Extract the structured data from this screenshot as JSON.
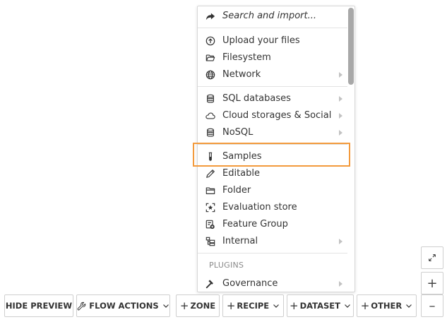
{
  "menu": {
    "items": [
      {
        "label": "Search and import...",
        "icon": "share-arrow-icon",
        "has_submenu": false
      },
      {
        "label": "Upload your files",
        "icon": "upload-circle-icon",
        "has_submenu": false
      },
      {
        "label": "Filesystem",
        "icon": "folder-open-icon",
        "has_submenu": false
      },
      {
        "label": "Network",
        "icon": "globe-icon",
        "has_submenu": true
      },
      {
        "label": "SQL databases",
        "icon": "database-icon",
        "has_submenu": true
      },
      {
        "label": "Cloud storages & Social",
        "icon": "cloud-icon",
        "has_submenu": true
      },
      {
        "label": "NoSQL",
        "icon": "database-icon",
        "has_submenu": true
      },
      {
        "label": "Samples",
        "icon": "test-tube-icon",
        "has_submenu": false
      },
      {
        "label": "Editable",
        "icon": "pencil-icon",
        "has_submenu": false
      },
      {
        "label": "Folder",
        "icon": "folder-icon",
        "has_submenu": false
      },
      {
        "label": "Evaluation store",
        "icon": "evaluation-star-icon",
        "has_submenu": false
      },
      {
        "label": "Feature Group",
        "icon": "feature-group-icon",
        "has_submenu": false
      },
      {
        "label": "Internal",
        "icon": "internal-icon",
        "has_submenu": true
      },
      {
        "label": "Governance",
        "icon": "gavel-icon",
        "has_submenu": true
      }
    ],
    "plugins_label": "PLUGINS",
    "highlighted": "Samples"
  },
  "toolbar": {
    "hide_preview": "HIDE PREVIEW",
    "flow_actions": "FLOW ACTIONS",
    "zone": "ZONE",
    "recipe": "RECIPE",
    "dataset": "DATASET",
    "other": "OTHER"
  },
  "zoom": {
    "fit_icon": "expand-arrows-icon",
    "zoom_in": "+",
    "zoom_out": "–"
  },
  "colors": {
    "highlight": "#f39a3c",
    "text": "#333333",
    "scrollbar": "#a8a8a8"
  }
}
